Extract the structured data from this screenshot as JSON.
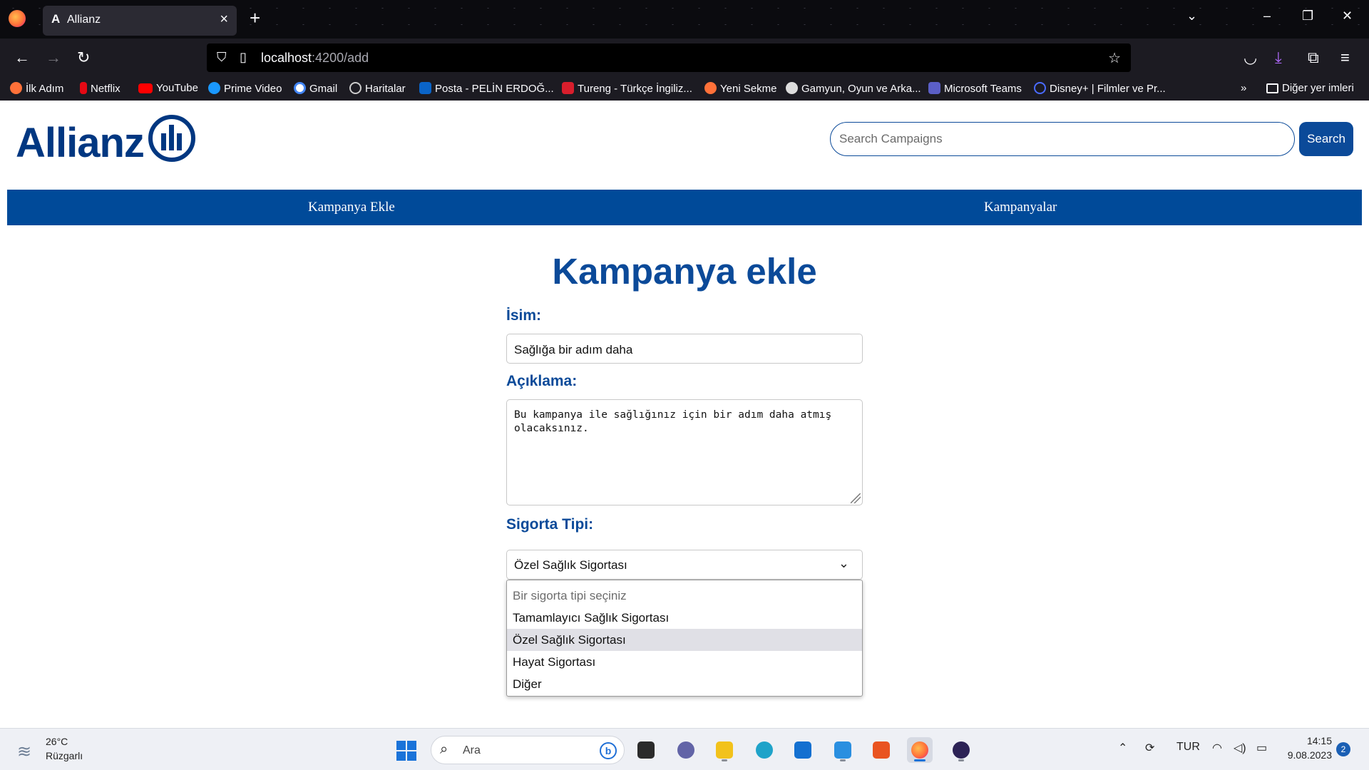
{
  "browser": {
    "tab_title": "Allianz",
    "tab_favicon": "A",
    "url_host": "localhost",
    "url_path": ":4200/add",
    "bookmarks": [
      {
        "label": "İlk Adım",
        "icon": "firefox-icon",
        "color": "#ff7139"
      },
      {
        "label": "Netflix",
        "icon": "netflix-icon",
        "color": "#e50914"
      },
      {
        "label": "YouTube",
        "icon": "youtube-icon",
        "color": "#ff0000"
      },
      {
        "label": "Prime Video",
        "icon": "prime-video-icon",
        "color": "#1a98ff"
      },
      {
        "label": "Gmail",
        "icon": "google-icon",
        "color": "#ffffff"
      },
      {
        "label": "Haritalar",
        "icon": "globe-icon",
        "color": "#cccccc"
      },
      {
        "label": "Posta - PELİN ERDOĞ...",
        "icon": "outlook-icon",
        "color": "#0a64c8"
      },
      {
        "label": "Tureng - Türkçe İngiliz...",
        "icon": "tureng-icon",
        "color": "#d81e2c"
      },
      {
        "label": "Yeni Sekme",
        "icon": "firefox-icon",
        "color": "#ff7139"
      },
      {
        "label": "Gamyun, Oyun ve Arka...",
        "icon": "people-icon",
        "color": "#dddddd"
      },
      {
        "label": "Microsoft Teams",
        "icon": "teams-icon",
        "color": "#5b5fc7"
      },
      {
        "label": "Disney+ | Filmler ve Pr...",
        "icon": "disney-icon",
        "color": "#1f3ca6"
      }
    ],
    "other_bookmarks": "Diğer yer imleri"
  },
  "header": {
    "logo_text": "Allianz",
    "search_placeholder": "Search Campaigns",
    "search_button": "Search"
  },
  "menu": {
    "add_campaign": "Kampanya Ekle",
    "campaigns": "Kampanyalar"
  },
  "form": {
    "title": "Kampanya ekle",
    "name_label": "İsim:",
    "name_value": "Sağlığa bir adım daha",
    "description_label": "Açıklama:",
    "description_value": "Bu kampanya ile sağlığınız için bir adım daha atmış olacaksınız.",
    "insurance_type_label": "Sigorta Tipi:",
    "insurance_type_value": "Özel Sağlık Sigortası",
    "insurance_options": [
      "Bir sigorta tipi seçiniz",
      "Tamamlayıcı Sağlık Sigortası",
      "Özel Sağlık Sigortası",
      "Hayat Sigortası",
      "Diğer"
    ]
  },
  "taskbar": {
    "weather_temp": "26°C",
    "weather_desc": "Rüzgarlı",
    "search_text": "Ara",
    "language": "TUR",
    "time": "14:15",
    "date": "9.08.2023",
    "notifications": "2"
  },
  "colors": {
    "brand": "#003781",
    "menu_bar": "#004a99",
    "accent": "#0b4a99"
  }
}
